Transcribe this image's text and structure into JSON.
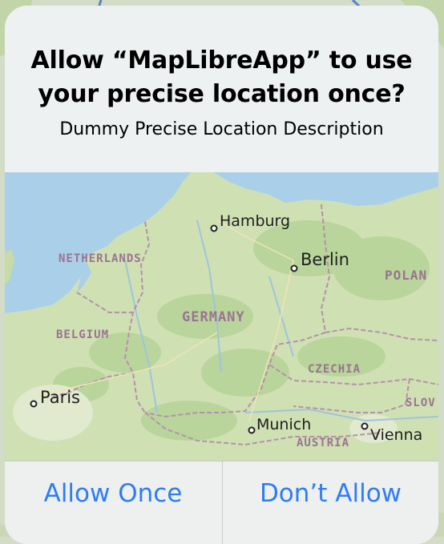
{
  "dialog": {
    "title_line1": "Allow “MapLibreApp” to use",
    "title_line2": "your precise location once?",
    "description": "Dummy Precise Location Description"
  },
  "map": {
    "countries": {
      "netherlands": "NETHERLANDS",
      "germany": "GERMANY",
      "belgium": "BELGIUM",
      "czechia": "CZECHIA",
      "poland": "POLAN",
      "slovakia": "SLOV",
      "austria": "AUSTRIA"
    },
    "cities": {
      "hamburg": "Hamburg",
      "berlin": "Berlin",
      "paris": "Paris",
      "munich": "Munich",
      "vienna": "Vienna"
    },
    "colors": {
      "water": "#a9cfe9",
      "land": "#d0e0b5",
      "forest": "#b9d49b",
      "border": "#b48fa8"
    }
  },
  "buttons": {
    "allow_once": "Allow Once",
    "dont_allow": "Don’t Allow"
  },
  "colors": {
    "accent": "#2f7cf6"
  }
}
